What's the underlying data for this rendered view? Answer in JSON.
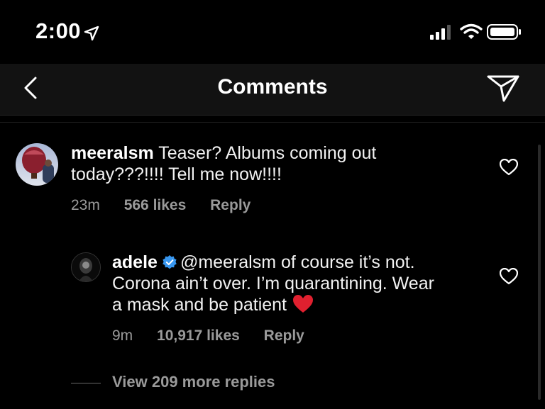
{
  "status_bar": {
    "time": "2:00",
    "location_icon": "location-arrow-icon",
    "signal_icon": "cellular-signal-icon",
    "wifi_icon": "wifi-icon",
    "battery_icon": "battery-icon"
  },
  "header": {
    "title": "Comments",
    "back_icon": "chevron-left-icon",
    "send_icon": "paper-plane-icon"
  },
  "comments": [
    {
      "username": "meeralsm",
      "text_line1": "Teaser? Albums coming out",
      "text_line2": "today???!!!! Tell me now!!!!",
      "time": "23m",
      "likes": "566 likes",
      "reply_label": "Reply"
    },
    {
      "username": "adele",
      "verified": true,
      "mention": "@meeralsm",
      "text_line1_rest": "of course it’s not.",
      "text_line2": "Corona ain’t over. I’m quarantining. Wear",
      "text_line3": "a mask and be patient",
      "emoji": "red-heart-emoji",
      "time": "9m",
      "likes": "10,917 likes",
      "reply_label": "Reply"
    }
  ],
  "view_more_replies": "View 209 more replies",
  "colors": {
    "background": "#000000",
    "header_bg": "#121212",
    "secondary_text": "#9a9a9a",
    "verified_blue": "#3897f0",
    "heart_red": "#ed4956"
  }
}
